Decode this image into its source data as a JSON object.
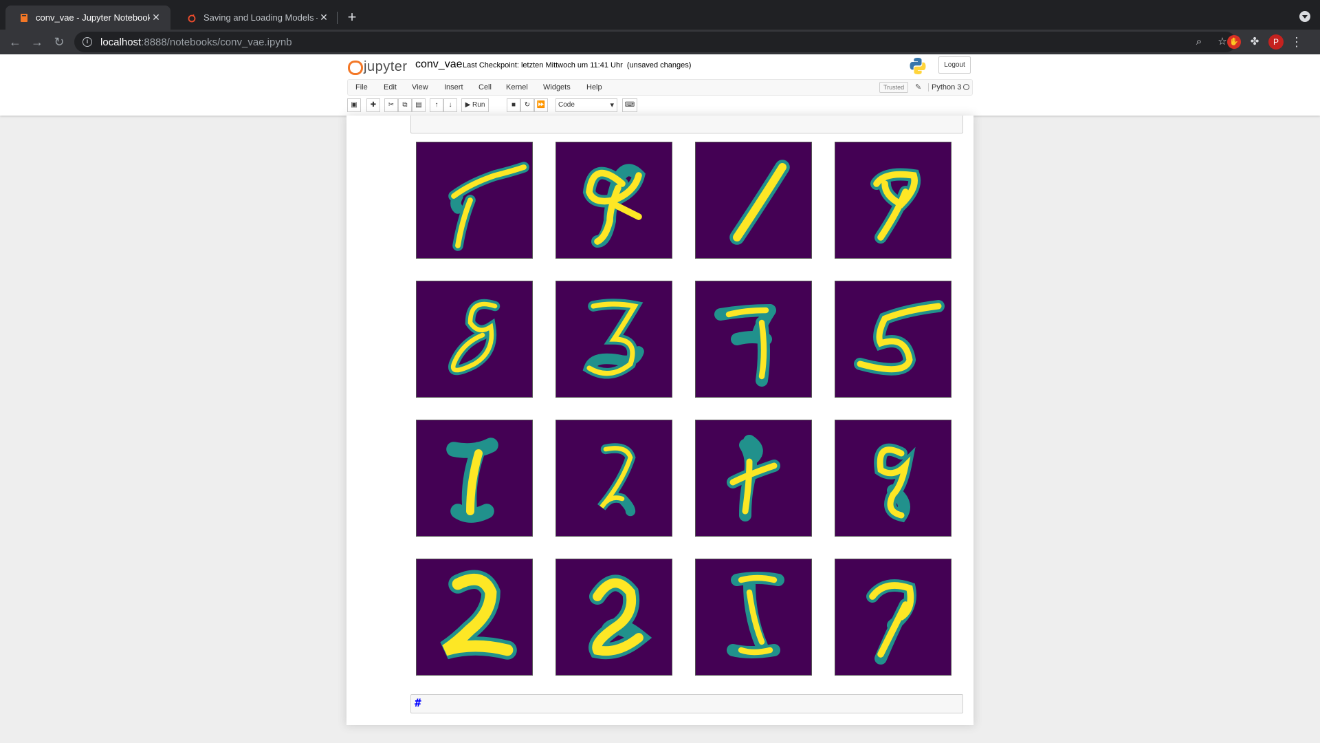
{
  "browser": {
    "tabs": [
      {
        "title": "conv_vae - Jupyter Notebook",
        "active": true,
        "favicon": "jupyter-book-icon"
      },
      {
        "title": "Saving and Loading Models —",
        "active": false,
        "favicon": "pytorch-icon"
      }
    ],
    "url_host": "localhost",
    "url_rest": ":8888/notebooks/conv_vae.ipynb",
    "profile_initial": "P"
  },
  "jupyter": {
    "logo_text": "jupyter",
    "notebook_name": "conv_vae",
    "checkpoint": "Last Checkpoint: letzten Mittwoch um 11:41 Uhr  (unsaved changes)",
    "logout_label": "Logout",
    "menus": [
      "File",
      "Edit",
      "View",
      "Insert",
      "Cell",
      "Kernel",
      "Widgets",
      "Help"
    ],
    "trusted_label": "Trusted",
    "kernel_name": "Python 3",
    "run_label": "Run",
    "cell_type": "Code"
  },
  "notebook": {
    "output_colormap": {
      "background": "#440154",
      "mid": "#21918c",
      "high": "#fde725"
    },
    "digits": [
      "7",
      "8",
      "1",
      "9",
      "8",
      "3",
      "7",
      "5",
      "1",
      "2",
      "7",
      "8",
      "2",
      "2",
      "5",
      "7"
    ],
    "next_cell_text": "#"
  }
}
